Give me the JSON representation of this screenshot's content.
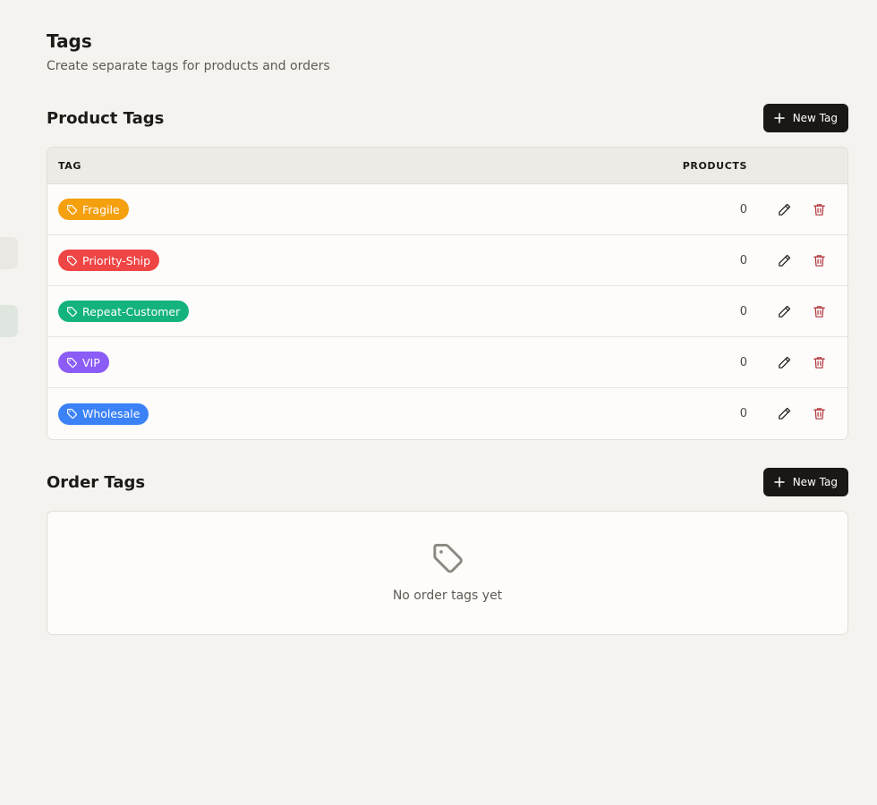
{
  "header": {
    "title": "Tags",
    "subtitle": "Create separate tags for products and orders"
  },
  "product_tags": {
    "title": "Product Tags",
    "new_button": "New Tag",
    "columns": {
      "tag": "TAG",
      "products": "PRODUCTS"
    },
    "rows": [
      {
        "name": "Fragile",
        "count": "0",
        "color": "#f5a00f"
      },
      {
        "name": "Priority-Ship",
        "count": "0",
        "color": "#ef4545"
      },
      {
        "name": "Repeat-Customer",
        "count": "0",
        "color": "#14b37d"
      },
      {
        "name": "VIP",
        "count": "0",
        "color": "#8b5cf6"
      },
      {
        "name": "Wholesale",
        "count": "0",
        "color": "#3b82f6"
      }
    ]
  },
  "order_tags": {
    "title": "Order Tags",
    "new_button": "New Tag",
    "empty_text": "No order tags yet"
  },
  "icons": {
    "new": "plus-icon",
    "pill": "tag-icon",
    "edit": "pencil-icon",
    "delete": "trash-icon",
    "empty": "tag-outline-icon"
  },
  "colors": {
    "background": "#f5f3ef",
    "button": "#1a1815",
    "delete_icon": "#b0343a"
  }
}
